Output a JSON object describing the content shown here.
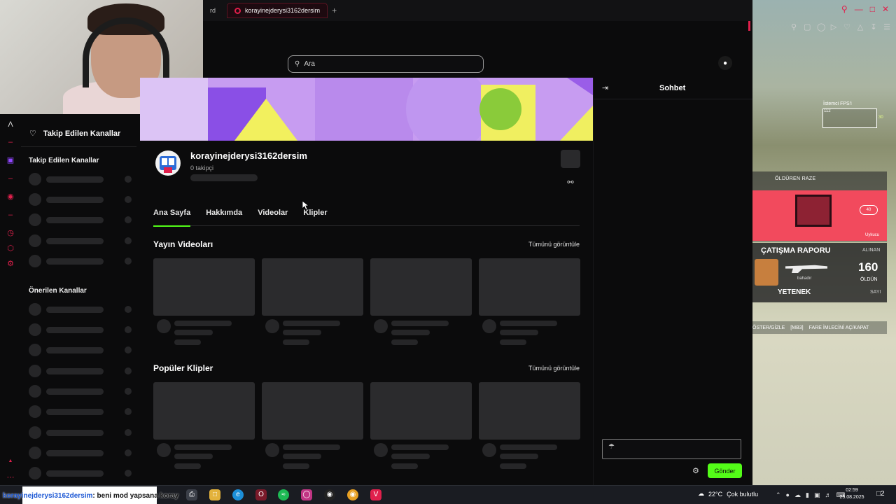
{
  "browser": {
    "prev_tab_fragment": "rd",
    "active_tab": "korayinejderysi3162dersim",
    "new_tab": "+",
    "window_controls": [
      "search",
      "minimize",
      "maximize",
      "close"
    ],
    "toolbar_icons": [
      "pin-icon",
      "crop-icon",
      "shield-icon",
      "play-icon",
      "heart-icon",
      "history-icon",
      "download-icon",
      "menu-icon"
    ]
  },
  "header": {
    "search_placeholder": "Ara"
  },
  "sidebar": {
    "top_item": "Takip Edilen Kanallar",
    "followed_heading": "Takip Edilen Kanallar",
    "recommended_heading": "Önerilen Kanallar",
    "followed_skeleton_rows": 5,
    "recommended_skeleton_rows": 9
  },
  "channel": {
    "name": "korayinejderysi3162dersim",
    "followers": "0 takipçi",
    "tabs": [
      {
        "label": "Ana Sayfa",
        "active": true
      },
      {
        "label": "Hakkımda",
        "active": false
      },
      {
        "label": "Videolar",
        "active": false
      },
      {
        "label": "Klipler",
        "active": false
      }
    ],
    "sections": [
      {
        "title": "Yayın Videoları",
        "see_all": "Tümünü görüntüle"
      },
      {
        "title": "Popüler Klipler",
        "see_all": "Tümünü görüntüle"
      }
    ]
  },
  "chat": {
    "title": "Sohbet",
    "send_label": "Gönder",
    "accent_color": "#53fc18"
  },
  "game_overlay": {
    "fps_label": "İstemci FPS'i",
    "fps_value": "112",
    "fps_right": "30",
    "killer_label": "ÖLDÜREN RAZE",
    "killer_level": "40",
    "killer_sub": "Uykucu",
    "report_title": "ÇATIŞMA RAPORU",
    "report_received": "ALINAN",
    "report_player": "bahadır",
    "report_number": "160",
    "report_killed": "ÖLDÜN",
    "report_skill": "YETENEK",
    "report_score": "SAYI",
    "hint_left": "ÖSTER/GİZLE",
    "hint_key": "[MB3]",
    "hint_right": "FARE İMLECİNİ AÇ/KAPAT"
  },
  "taskbar": {
    "ticker_user": "korayinejderysi3162dersim",
    "ticker_msg": ": beni mod yapsana koray",
    "weather_temp": "22°C",
    "weather_text": "Çok bulutlu",
    "time": "02:59",
    "date": "25.08.2025",
    "notification_count": "2"
  }
}
